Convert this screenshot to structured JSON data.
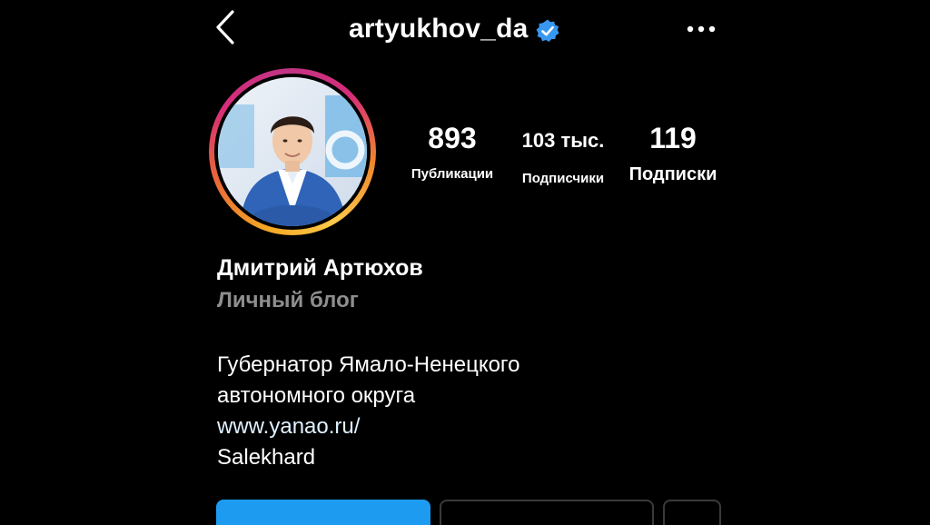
{
  "header": {
    "back_icon": "chevron-left-icon",
    "username": "artyukhov_da",
    "verified_icon": "verified-badge-icon",
    "more_icon": "more-horizontal-icon"
  },
  "profile": {
    "avatar_description": "profile-photo",
    "stats": {
      "posts": {
        "value": "893",
        "label": "Публикации"
      },
      "followers": {
        "value": "103 тыс.",
        "label": "Подписчики"
      },
      "following": {
        "value": "119",
        "label": "Подписки"
      }
    },
    "name": "Дмитрий Артюхов",
    "category": "Личный блог",
    "bio_lines": [
      "Губернатор Ямало-Ненецкого",
      "автономного округа"
    ],
    "website": "www.yanao.ru/",
    "location": "Salekhard"
  },
  "actions": {
    "follow_label": "",
    "message_label": "",
    "more_icon": "chevron-down-icon"
  },
  "colors": {
    "background": "#000000",
    "text": "#ffffff",
    "secondary_text": "#8e8e8e",
    "verified_blue": "#3897f0",
    "primary_button": "#1d9bf0"
  }
}
